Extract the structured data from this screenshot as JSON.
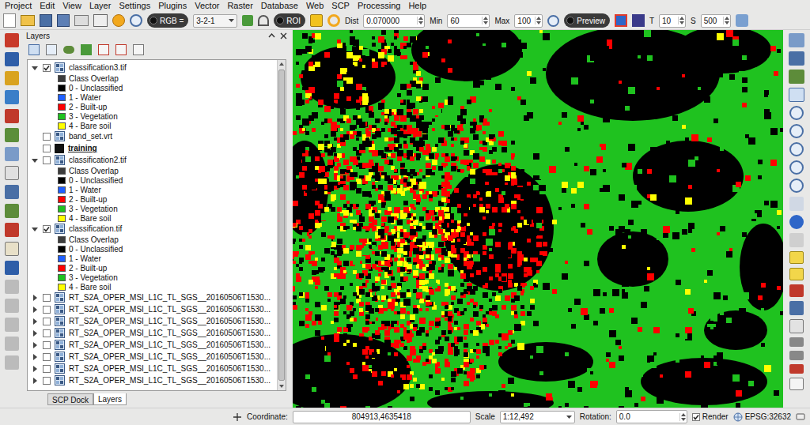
{
  "window": {
    "menu": [
      "Project",
      "Edit",
      "View",
      "Layer",
      "Settings",
      "Plugins",
      "Vector",
      "Raster",
      "Database",
      "Web",
      "SCP",
      "Processing",
      "Help"
    ]
  },
  "toolbar": {
    "rgb_label": "RGB =",
    "rgb_value": "3-2-1",
    "roi_label": "ROI",
    "dist_label": "Dist",
    "dist_value": "0.070000",
    "min_label": "Min",
    "min_value": "60",
    "max_label": "Max",
    "max_value": "100",
    "preview_label": "Preview",
    "t_label": "T",
    "t_value": "10",
    "s_label": "S",
    "s_value": "500"
  },
  "layers_panel": {
    "title": "Layers",
    "layers": [
      {
        "name": "classification3.tif",
        "kind": "raster",
        "checked": true,
        "expanded": true,
        "classes": [
          {
            "label": "Class Overlap",
            "color": "#3c3c3c"
          },
          {
            "label": "0 - Unclassified",
            "color": "#000000"
          },
          {
            "label": "1 - Water",
            "color": "#1f5fff"
          },
          {
            "label": "2 - Built-up",
            "color": "#ff0000"
          },
          {
            "label": "3 - Vegetation",
            "color": "#1fc21f"
          },
          {
            "label": "4 - Bare soil",
            "color": "#ffff00"
          }
        ]
      },
      {
        "name": "band_set.vrt",
        "kind": "file",
        "checked": false,
        "expanded": false,
        "classes": []
      },
      {
        "name": "training",
        "kind": "group",
        "checked": false,
        "expanded": false,
        "classes": []
      },
      {
        "name": "classification2.tif",
        "kind": "raster",
        "checked": false,
        "expanded": true,
        "classes": [
          {
            "label": "Class Overlap",
            "color": "#3c3c3c"
          },
          {
            "label": "0 - Unclassified",
            "color": "#000000"
          },
          {
            "label": "1 - Water",
            "color": "#1f5fff"
          },
          {
            "label": "2 - Built-up",
            "color": "#ff0000"
          },
          {
            "label": "3 - Vegetation",
            "color": "#1fc21f"
          },
          {
            "label": "4 - Bare soil",
            "color": "#ffff00"
          }
        ]
      },
      {
        "name": "classification.tif",
        "kind": "raster",
        "checked": true,
        "expanded": true,
        "classes": [
          {
            "label": "Class Overlap",
            "color": "#3c3c3c"
          },
          {
            "label": "0 - Unclassified",
            "color": "#000000"
          },
          {
            "label": "1 - Water",
            "color": "#1f5fff"
          },
          {
            "label": "2 - Built-up",
            "color": "#ff0000"
          },
          {
            "label": "3 - Vegetation",
            "color": "#1fc21f"
          },
          {
            "label": "4 - Bare soil",
            "color": "#ffff00"
          }
        ]
      },
      {
        "name": "RT_S2A_OPER_MSI_L1C_TL_SGS__20160506T1530...",
        "kind": "raster",
        "checked": false,
        "expanded": false,
        "classes": []
      },
      {
        "name": "RT_S2A_OPER_MSI_L1C_TL_SGS__20160506T1530...",
        "kind": "raster",
        "checked": false,
        "expanded": false,
        "classes": []
      },
      {
        "name": "RT_S2A_OPER_MSI_L1C_TL_SGS__20160506T1530...",
        "kind": "raster",
        "checked": false,
        "expanded": false,
        "classes": []
      },
      {
        "name": "RT_S2A_OPER_MSI_L1C_TL_SGS__20160506T1530...",
        "kind": "raster",
        "checked": false,
        "expanded": false,
        "classes": []
      },
      {
        "name": "RT_S2A_OPER_MSI_L1C_TL_SGS__20160506T1530...",
        "kind": "raster",
        "checked": false,
        "expanded": false,
        "classes": []
      },
      {
        "name": "RT_S2A_OPER_MSI_L1C_TL_SGS__20160506T1530...",
        "kind": "raster",
        "checked": false,
        "expanded": false,
        "classes": []
      },
      {
        "name": "RT_S2A_OPER_MSI_L1C_TL_SGS__20160506T1530...",
        "kind": "raster",
        "checked": false,
        "expanded": false,
        "classes": []
      },
      {
        "name": "RT_S2A_OPER_MSI_L1C_TL_SGS__20160506T1530...",
        "kind": "raster",
        "checked": false,
        "expanded": false,
        "classes": []
      }
    ],
    "tabs": [
      {
        "label": "SCP Dock",
        "selected": false
      },
      {
        "label": "Layers",
        "selected": true
      }
    ]
  },
  "status_bar": {
    "coordinate_label": "Coordinate:",
    "coordinate": "804913,4635418",
    "scale_label": "Scale",
    "scale": "1:12,492",
    "rotation_label": "Rotation:",
    "rotation": "0.0",
    "render_label": "Render",
    "render_checked": true,
    "crs": "EPSG:32632"
  }
}
